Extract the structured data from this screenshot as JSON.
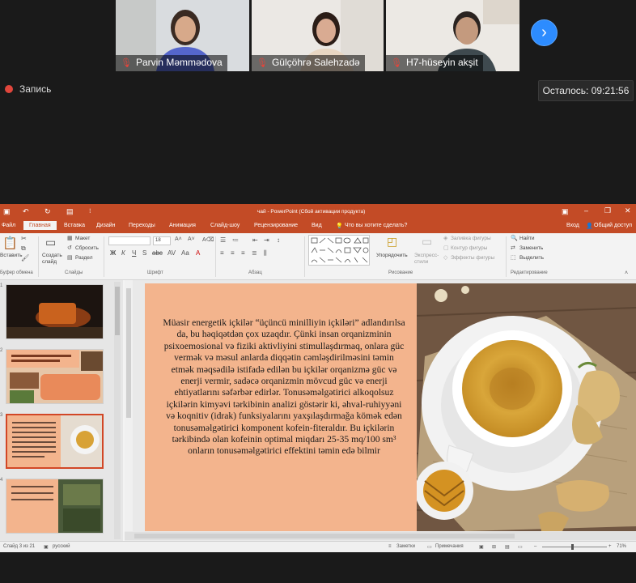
{
  "participants": [
    {
      "name": "Parvin Məmmədova"
    },
    {
      "name": "Gülçöhrə Salehzadə"
    },
    {
      "name": "H7-hüseyin akşit"
    }
  ],
  "next_icon": "chevron-right-icon",
  "recording_label": "Запись",
  "remaining": "Осталось: 09:21:56",
  "ppt": {
    "title": "чай - PowerPoint (Сбой активации продукта)",
    "signin": "Вход",
    "share": "Общий доступ",
    "tabs": [
      "Файл",
      "Главная",
      "Вставка",
      "Дизайн",
      "Переходы",
      "Анимация",
      "Слайд-шоу",
      "Рецензирование",
      "Вид"
    ],
    "tell_me": "Что вы хотите сделать?",
    "ribbon": {
      "paste": "Вставить",
      "clipboard": "Буфер обмена",
      "new_slide": "Создать слайд",
      "layout": "Макет",
      "reset": "Сбросить",
      "section": "Раздел",
      "slides": "Слайды",
      "font": "Шрифт",
      "font_size": "18",
      "paragraph": "Абзац",
      "arrange": "Упорядочить",
      "quick_styles": "Экспресс-стили",
      "fill": "Заливка фигуры",
      "outline": "Контур фигуры",
      "effects": "Эффекты фигуры",
      "drawing": "Рисование",
      "find": "Найти",
      "replace": "Заменить",
      "select": "Выделить",
      "editing": "Редактирование"
    },
    "thumb_numbers": [
      "1",
      "2",
      "3",
      "4"
    ],
    "slide_text": "Müasir energetik içkilər “üçüncü minilliyin içkiləri” adlandırılsa da, bu həqiqətdən çox uzaqdır. Çünki insan orqanizminin psixoemosional və fiziki aktivliyini stimullaşdırmaq, onlara güc vermək və məsul anlarda diqqətin cəmləşdirilməsini təmin etmək məqsədilə istifadə edilən bu içkilər orqanizmə güc və enerji vermir, sadəcə orqanizmin mövcud güc və enerji ehtiyatlarını səfərbər edirlər. Tonusəməlgətirici alkoqolsuz içkilərin kimyəvi tərkibinin analizi göstərir ki, əhval-ruhiyyəni və koqnitiv (idrak) funksiyalarını yaxşılaşdırmağa kömək edən tonusəməlgətirici komponent kofein-fiteraldır. Bu içkilərin tərkibində olan kofeinin  optimal miqdarı 25-35 mq/100 sm³ onların tonusəməlgətirici effektini təmin edə bilmir",
    "status": {
      "slide_info": "Слайд 3 из 21",
      "language": "русский",
      "notes": "Заметки",
      "comments": "Примечания",
      "zoom": "71%"
    }
  },
  "colors": {
    "ppt_accent": "#c34b26",
    "slide_bg": "#f3b48d",
    "zoom_blue": "#2d8cff",
    "rec_red": "#e0463c"
  }
}
